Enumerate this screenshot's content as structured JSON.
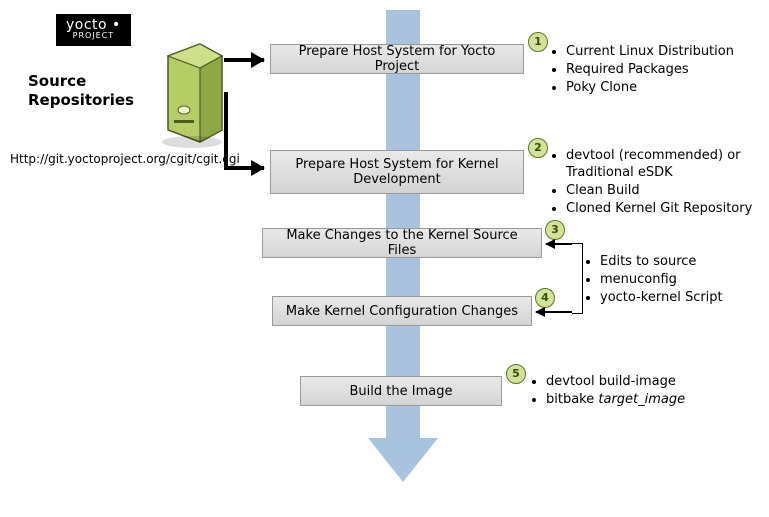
{
  "logo": {
    "name": "yocto",
    "dot": " •",
    "sub": "PROJECT"
  },
  "source": {
    "title_line1": "Source",
    "title_line2": "Repositories",
    "url": "Http://git.yoctoproject.org/cgit/cgit.cgi"
  },
  "steps": {
    "s1": {
      "label": "Prepare Host System for Yocto Project",
      "num": "1",
      "notes": [
        "Current Linux Distribution",
        "Required Packages",
        "Poky Clone"
      ]
    },
    "s2": {
      "label": "Prepare Host System for Kernel Development",
      "num": "2",
      "notes": [
        "devtool (recommended) or Traditional eSDK",
        "Clean Build",
        "Cloned Kernel Git Repository"
      ]
    },
    "s3": {
      "label": "Make Changes to the Kernel Source Files",
      "num": "3"
    },
    "s4": {
      "label": "Make Kernel Configuration Changes",
      "num": "4"
    },
    "s34notes": [
      "Edits to source",
      "menuconfig",
      "yocto-kernel Script"
    ],
    "s5": {
      "label": "Build the Image",
      "num": "5",
      "notes_a": "devtool build-image",
      "notes_b_pre": "bitbake ",
      "notes_b_ital": "target_image"
    }
  }
}
